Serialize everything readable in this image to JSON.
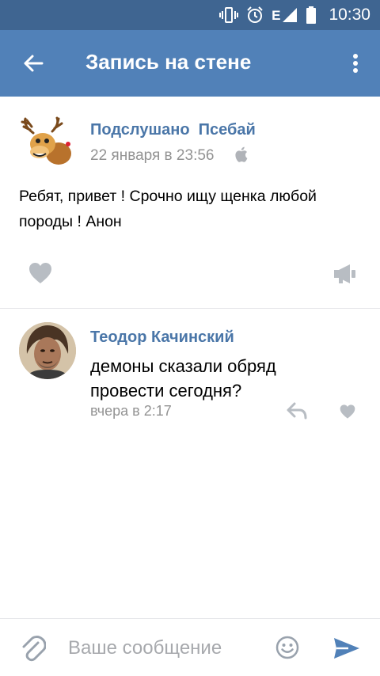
{
  "status_bar": {
    "time": "10:30",
    "network_label": "E",
    "icons": [
      "vibrate-icon",
      "alarm-icon",
      "signal-icon",
      "battery-icon"
    ]
  },
  "header": {
    "title": "Запись на стене",
    "back_icon": "arrow-left-icon",
    "more_icon": "more-vertical-icon"
  },
  "post": {
    "author": "Подслушано  Псебай",
    "date": "22 января в 23:56",
    "platform_icon": "apple-icon",
    "text": "Ребят, привет ! Срочно ищу щенка любой породы ! Анон",
    "actions": [
      "heart-icon",
      "megaphone-icon"
    ]
  },
  "comment": {
    "author": "Теодор Качинский",
    "text": "демоны сказали обряд провести сегодня?",
    "time": "вчера в 2:17",
    "actions": [
      "reply-icon",
      "heart-icon"
    ]
  },
  "composer": {
    "placeholder": "Ваше сообщение",
    "value": "",
    "icons": [
      "paperclip-icon",
      "smile-icon",
      "send-icon"
    ]
  },
  "colors": {
    "statusbar": "#3f6591",
    "header": "#5181b8",
    "link": "#4a76a8",
    "muted": "#939393",
    "icon_grey": "#b8bdc3"
  }
}
